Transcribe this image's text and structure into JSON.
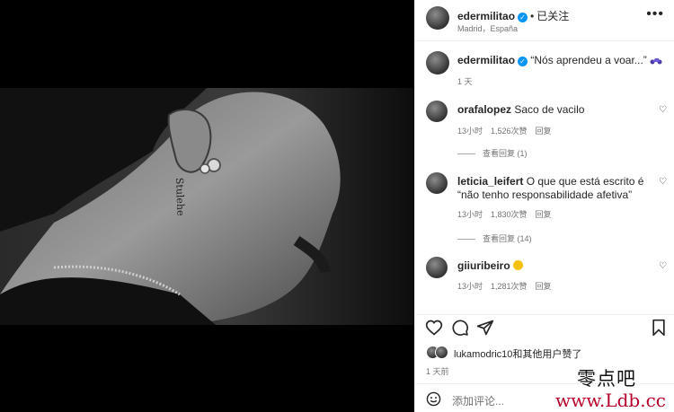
{
  "post": {
    "username": "edermilitao",
    "separator": "•",
    "follow_state": "已关注",
    "location": "Madrid，España"
  },
  "caption": {
    "username": "edermilitao",
    "text": "“Nós aprendeu a voar...”",
    "emoji": "motorcycle",
    "time": "1 天"
  },
  "comments": [
    {
      "username": "orafalopez",
      "text": "Saco de vacilo",
      "time": "13小时",
      "likes": "1,526次赞",
      "reply": "回复",
      "view_replies": "查看回复 (1)"
    },
    {
      "username": "leticia_leifert",
      "text": "O que que está escrito é “não tenho responsabilidade afetiva”",
      "time": "13小时",
      "likes": "1,830次赞",
      "reply": "回复",
      "view_replies": "查看回复 (14)"
    },
    {
      "username": "giiuribeiro",
      "text": "",
      "emoji": "crying-face",
      "time": "13小时",
      "likes": "1,281次赞",
      "reply": "回复"
    }
  ],
  "likes": {
    "text": "lukamodric10和其他用户赞了"
  },
  "age": "1 天前",
  "add_comment": {
    "placeholder": "添加评论..."
  },
  "watermark": {
    "line1": "零点吧",
    "line2": "www.Ldb.cc"
  },
  "icons": [
    "more-icon",
    "verified-icon",
    "heart-icon",
    "comment-icon",
    "share-icon",
    "bookmark-icon",
    "smile-icon"
  ]
}
